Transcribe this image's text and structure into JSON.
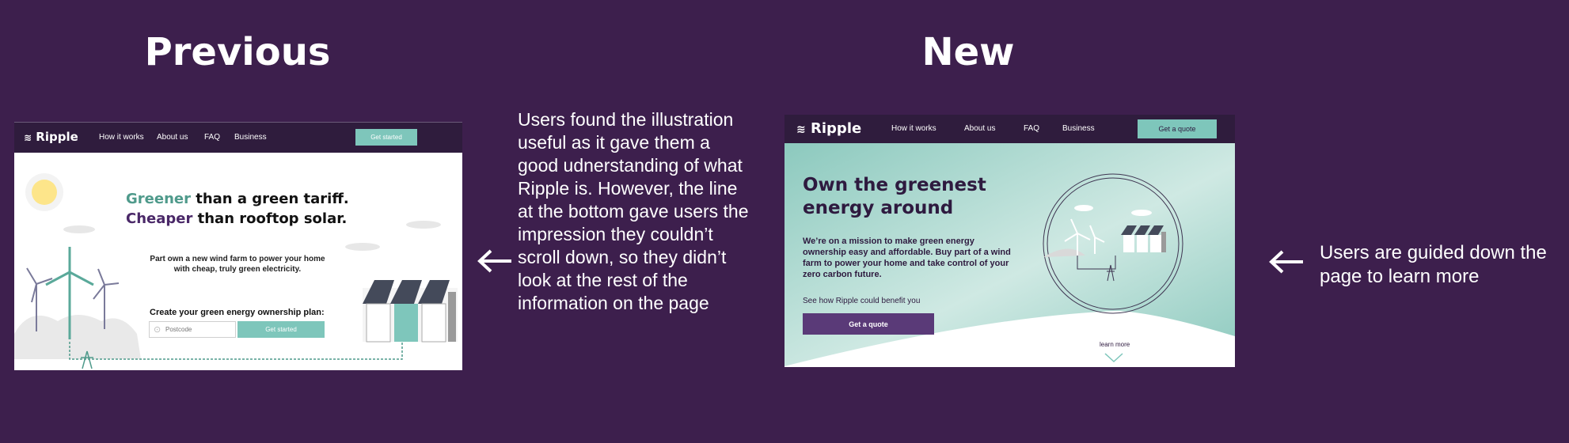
{
  "headings": {
    "previous": "Previous",
    "new": "New"
  },
  "previous_mockup": {
    "logo": "Ripple",
    "nav": [
      "How it works",
      "About us",
      "FAQ",
      "Business"
    ],
    "nav_cta": "Get started",
    "hero_line1_accent": "Greener",
    "hero_line1_rest": " than a green tariff.",
    "hero_line2_accent": "Cheaper",
    "hero_line2_rest": " than rooftop solar.",
    "subtitle": "Part own a new wind farm to power your home with cheap, truly green electricity.",
    "plan_label": "Create your green energy ownership plan:",
    "postcode_placeholder": "Postcode",
    "cta": "Get started"
  },
  "new_mockup": {
    "logo": "Ripple",
    "nav": [
      "How it works",
      "About us",
      "FAQ",
      "Business"
    ],
    "nav_cta": "Get a quote",
    "hero_title": "Own the greenest energy around",
    "subtitle": "We’re on a mission to make green energy ownership easy and affordable. Buy part of a wind farm to power your home and take control of your zero carbon future.",
    "see_how": "See how Ripple could benefit you",
    "cta": "Get a quote",
    "learn_more": "learn more"
  },
  "captions": {
    "left": "Users found the illustration useful as it gave them a good udnerstanding of what Ripple is. However, the line at the bottom gave users the impression they couldn’t scroll down, so they didn’t look at the rest of the information on the page",
    "right": "Users are guided down the page to learn more"
  },
  "colors": {
    "background": "#3d1f4d",
    "nav": "#2f1c3d",
    "teal": "#7ec6bb",
    "purple": "#5a3a78"
  },
  "icons": [
    "left-arrow-icon",
    "wind-turbine-icon",
    "house-icon",
    "pylon-icon",
    "sun-icon",
    "cloud-icon",
    "chevron-down-icon",
    "location-pin-icon",
    "ripple-logo-icon"
  ]
}
